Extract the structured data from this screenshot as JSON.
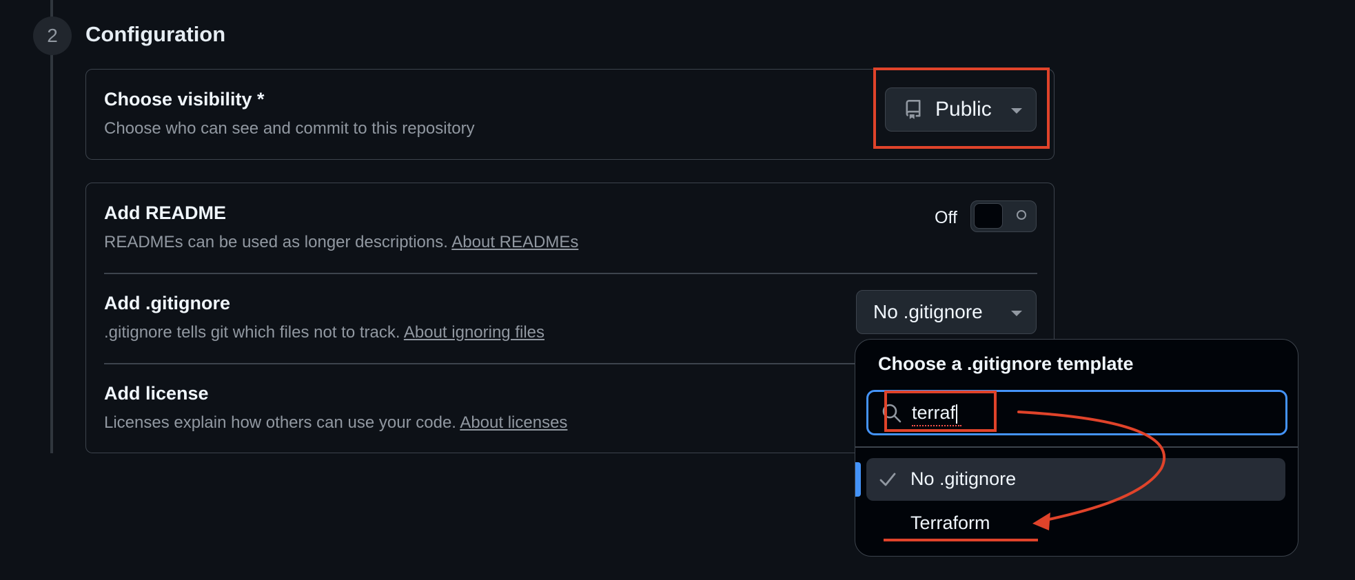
{
  "step": {
    "number": "2",
    "title": "Configuration"
  },
  "visibility": {
    "title": "Choose visibility *",
    "description": "Choose who can see and commit to this repository",
    "button_label": "Public"
  },
  "readme": {
    "title": "Add README",
    "description": "READMEs can be used as longer descriptions.",
    "link": "About READMEs",
    "toggle_state": "Off"
  },
  "gitignore": {
    "title": "Add .gitignore",
    "description": ".gitignore tells git which files not to track.",
    "link": "About ignoring files",
    "button_label": "No .gitignore"
  },
  "license": {
    "title": "Add license",
    "description": "Licenses explain how others can use your code.",
    "link": "About licenses"
  },
  "gitignore_popover": {
    "title": "Choose a .gitignore template",
    "search_value": "terraf",
    "options": [
      {
        "label": "No .gitignore",
        "selected": true
      },
      {
        "label": "Terraform",
        "selected": false
      }
    ]
  },
  "icons": {
    "repo": "repo-icon",
    "caret": "triangle-down-icon",
    "search": "search-icon",
    "check": "check-icon"
  },
  "colors": {
    "background": "#0d1117",
    "accent": "#4493f8",
    "annotation": "#e0432a"
  }
}
